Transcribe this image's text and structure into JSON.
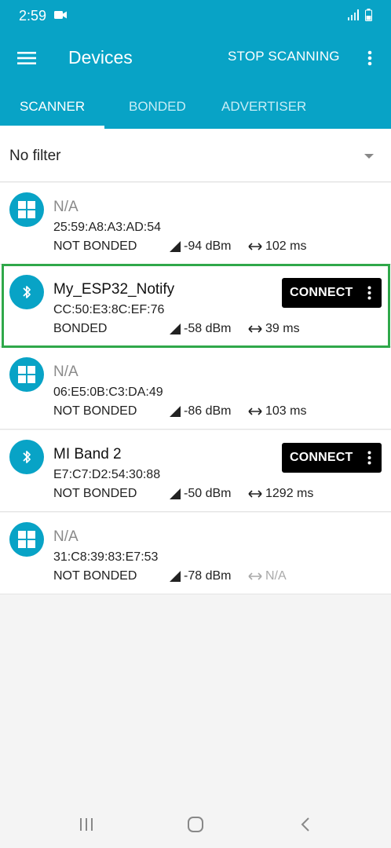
{
  "status_bar": {
    "time": "2:59"
  },
  "toolbar": {
    "title": "Devices",
    "stop_label": "STOP SCANNING"
  },
  "tabs": [
    {
      "label": "SCANNER",
      "active": true
    },
    {
      "label": "BONDED",
      "active": false
    },
    {
      "label": "ADVERTISER",
      "active": false
    }
  ],
  "filter": {
    "label": "No filter"
  },
  "devices": [
    {
      "icon": "windows-icon",
      "name": "N/A",
      "address": "25:59:A8:A3:AD:54",
      "bond": "NOT BONDED",
      "rssi": "-94 dBm",
      "interval": "102 ms",
      "connect": ""
    },
    {
      "icon": "bluetooth-icon",
      "name": "My_ESP32_Notify",
      "address": "CC:50:E3:8C:EF:76",
      "bond": "BONDED",
      "rssi": "-58 dBm",
      "interval": "39 ms",
      "connect": "CONNECT"
    },
    {
      "icon": "windows-icon",
      "name": "N/A",
      "address": "06:E5:0B:C3:DA:49",
      "bond": "NOT BONDED",
      "rssi": "-86 dBm",
      "interval": "103 ms",
      "connect": ""
    },
    {
      "icon": "bluetooth-icon",
      "name": "MI Band 2",
      "address": "E7:C7:D2:54:30:88",
      "bond": "NOT BONDED",
      "rssi": "-50 dBm",
      "interval": "1292 ms",
      "connect": "CONNECT"
    },
    {
      "icon": "windows-icon",
      "name": "N/A",
      "address": "31:C8:39:83:E7:53",
      "bond": "NOT BONDED",
      "rssi": "-78 dBm",
      "interval": "N/A",
      "connect": ""
    }
  ],
  "colors": {
    "primary": "#08a3c6",
    "highlight": "#2fa84a",
    "connect_bg": "#000000"
  }
}
